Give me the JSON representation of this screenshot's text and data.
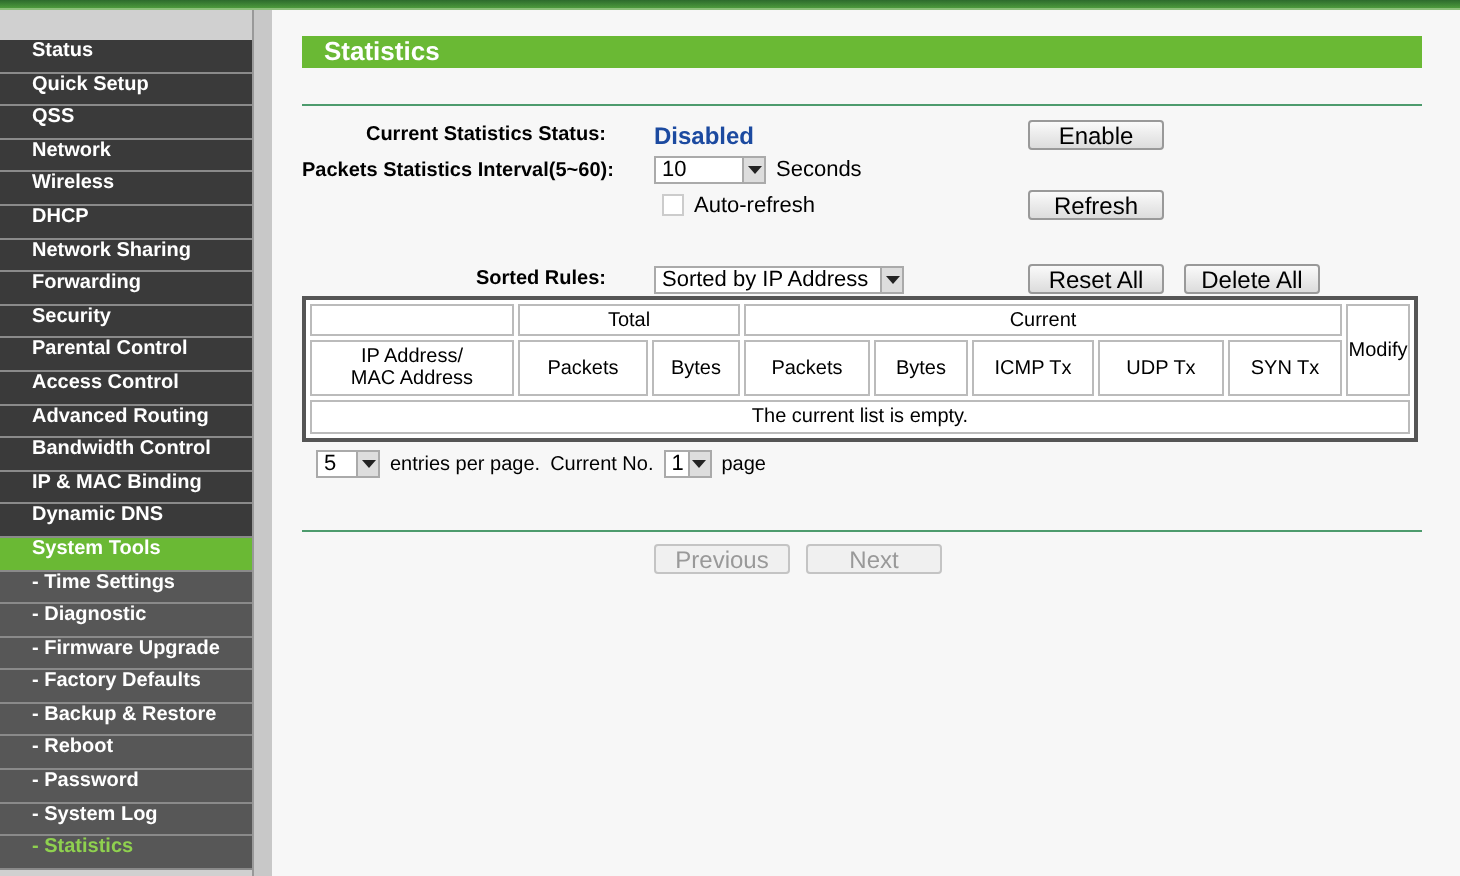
{
  "sidebar": {
    "items": [
      {
        "label": "Status",
        "kind": "main",
        "selected": false
      },
      {
        "label": "Quick Setup",
        "kind": "main",
        "selected": false
      },
      {
        "label": "QSS",
        "kind": "main",
        "selected": false
      },
      {
        "label": "Network",
        "kind": "main",
        "selected": false
      },
      {
        "label": "Wireless",
        "kind": "main",
        "selected": false
      },
      {
        "label": "DHCP",
        "kind": "main",
        "selected": false
      },
      {
        "label": "Network Sharing",
        "kind": "main",
        "selected": false
      },
      {
        "label": "Forwarding",
        "kind": "main",
        "selected": false
      },
      {
        "label": "Security",
        "kind": "main",
        "selected": false
      },
      {
        "label": "Parental Control",
        "kind": "main",
        "selected": false
      },
      {
        "label": "Access Control",
        "kind": "main",
        "selected": false
      },
      {
        "label": "Advanced Routing",
        "kind": "main",
        "selected": false
      },
      {
        "label": "Bandwidth Control",
        "kind": "main",
        "selected": false
      },
      {
        "label": "IP & MAC Binding",
        "kind": "main",
        "selected": false
      },
      {
        "label": "Dynamic DNS",
        "kind": "main",
        "selected": false
      },
      {
        "label": "System Tools",
        "kind": "main",
        "selected": true
      },
      {
        "label": "- Time Settings",
        "kind": "sub",
        "selected": false
      },
      {
        "label": "- Diagnostic",
        "kind": "sub",
        "selected": false
      },
      {
        "label": "- Firmware Upgrade",
        "kind": "sub",
        "selected": false
      },
      {
        "label": "- Factory Defaults",
        "kind": "sub",
        "selected": false
      },
      {
        "label": "- Backup & Restore",
        "kind": "sub",
        "selected": false
      },
      {
        "label": "- Reboot",
        "kind": "sub",
        "selected": false
      },
      {
        "label": "- Password",
        "kind": "sub",
        "selected": false
      },
      {
        "label": "- System Log",
        "kind": "sub",
        "selected": false
      },
      {
        "label": "- Statistics",
        "kind": "sub",
        "selected": true
      }
    ]
  },
  "page": {
    "title": "Statistics",
    "status": {
      "label": "Current Statistics Status:",
      "value": "Disabled",
      "button": {
        "label": "Enable",
        "disabled": false
      }
    },
    "interval": {
      "label": "Packets Statistics Interval(5~60):",
      "value": "10",
      "unit": "Seconds"
    },
    "auto_refresh": {
      "label": "Auto-refresh",
      "checked": false
    },
    "refresh_button": {
      "label": "Refresh",
      "disabled": false
    },
    "sort": {
      "label": "Sorted Rules:",
      "value": "Sorted by IP Address"
    },
    "sort_buttons": [
      {
        "label": "Reset All",
        "disabled": false
      },
      {
        "label": "Delete All",
        "disabled": false
      }
    ],
    "table": {
      "groups": [
        "Total",
        "Current"
      ],
      "modify": "Modify",
      "columns": [
        "IP Address/\nMAC Address",
        "Packets",
        "Bytes",
        "Packets",
        "Bytes",
        "ICMP Tx",
        "UDP Tx",
        "SYN Tx"
      ],
      "empty": "The current list is empty."
    },
    "pager": {
      "per_page": "5",
      "per_page_label": "entries per page.",
      "current_label": "Current No.",
      "current": "1",
      "page_label": "page"
    },
    "nav_buttons": [
      {
        "label": "Previous",
        "disabled": true
      },
      {
        "label": "Next",
        "disabled": true
      }
    ]
  }
}
